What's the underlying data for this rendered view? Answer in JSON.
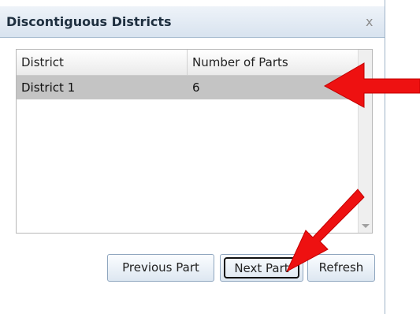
{
  "dialog": {
    "title": "Discontiguous Districts",
    "close_label": "x"
  },
  "grid": {
    "columns": [
      "District",
      "Number of Parts"
    ],
    "rows": [
      {
        "district": "District 1",
        "parts": "6"
      }
    ]
  },
  "buttons": {
    "previous": "Previous Part",
    "next": "Next Part",
    "refresh": "Refresh"
  },
  "annotations": {
    "arrow_color": "#ee1111"
  }
}
